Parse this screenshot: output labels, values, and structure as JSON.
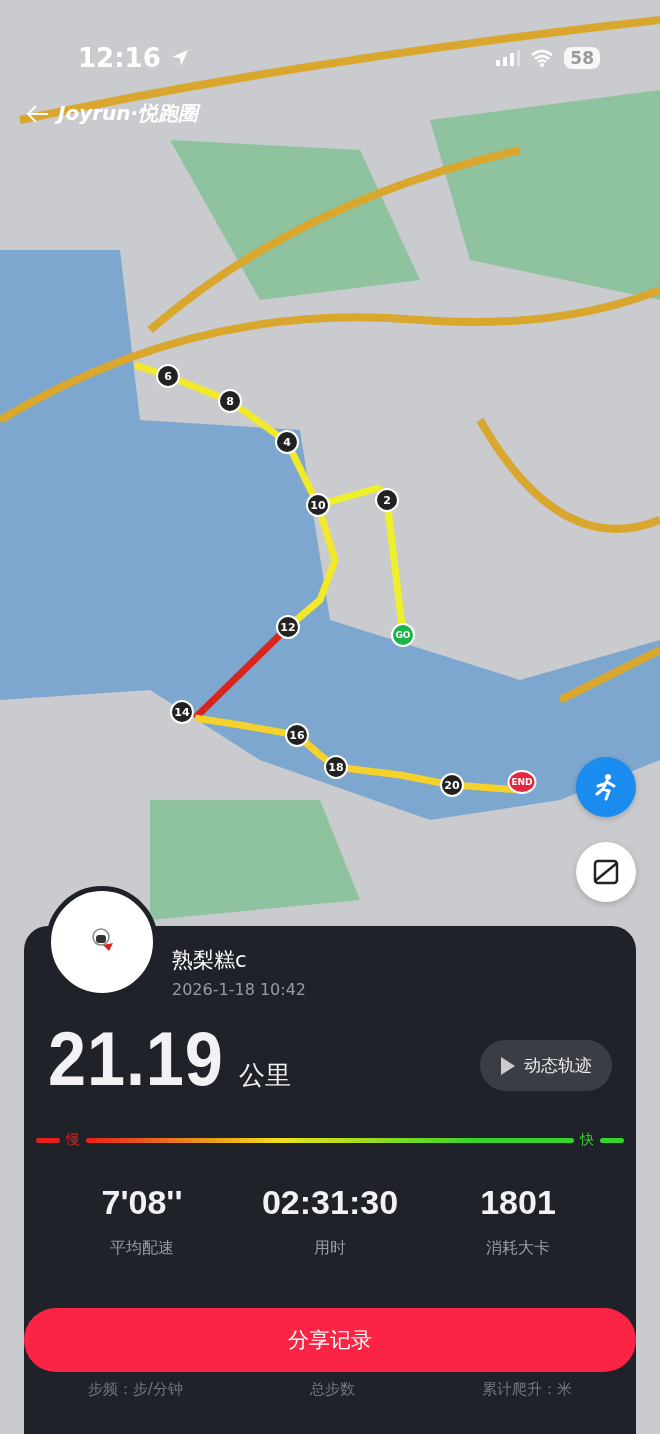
{
  "status_bar": {
    "time": "12:16",
    "battery": "58"
  },
  "header": {
    "brand": "Joyrun",
    "brand_suffix": "·悦跑圈"
  },
  "route_markers": [
    {
      "label": "6",
      "kind": "km"
    },
    {
      "label": "8",
      "kind": "km"
    },
    {
      "label": "4",
      "kind": "km"
    },
    {
      "label": "10",
      "kind": "km"
    },
    {
      "label": "2",
      "kind": "km"
    },
    {
      "label": "12",
      "kind": "km"
    },
    {
      "label": "14",
      "kind": "km"
    },
    {
      "label": "16",
      "kind": "km"
    },
    {
      "label": "18",
      "kind": "km"
    },
    {
      "label": "20",
      "kind": "km"
    },
    {
      "label": "GO",
      "kind": "start"
    },
    {
      "label": "END",
      "kind": "end"
    }
  ],
  "summary": {
    "user_name": "熟梨糕c",
    "datetime": "2026-1-18 10:42",
    "distance": "21.19",
    "distance_unit": "公里",
    "replay_button": "动态轨迹",
    "pace_slow": "慢",
    "pace_fast": "快",
    "stats": [
      {
        "value": "7'08''",
        "label": "平均配速"
      },
      {
        "value": "02:31:30",
        "label": "用时"
      },
      {
        "value": "1801",
        "label": "消耗大卡"
      }
    ],
    "share_button": "分享记录",
    "hidden_stats": [
      "步频：步/分钟",
      "总步数",
      "累计爬升：米"
    ]
  }
}
